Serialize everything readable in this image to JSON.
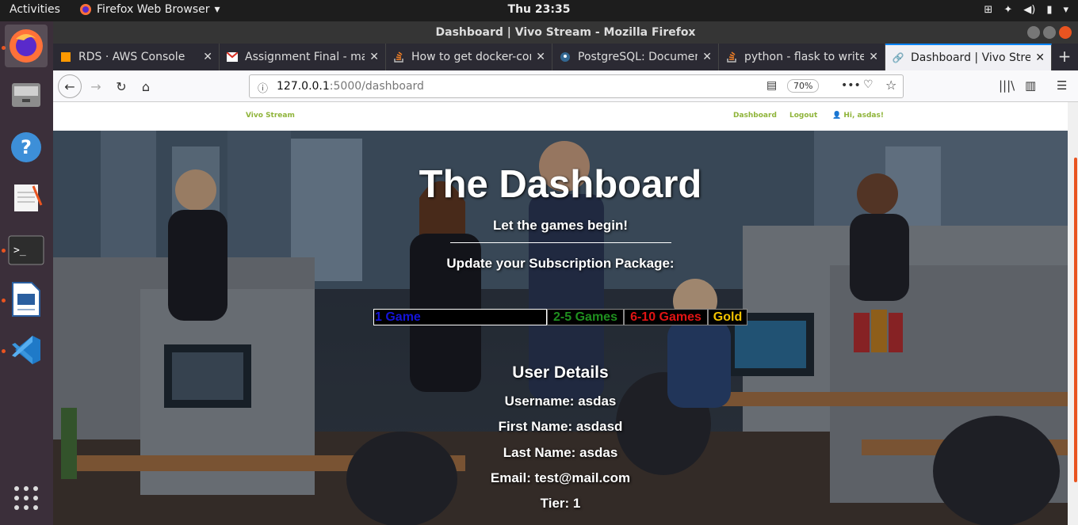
{
  "topbar": {
    "activities": "Activities",
    "app_name": "Firefox Web Browser",
    "clock": "Thu 23:35"
  },
  "window": {
    "title": "Dashboard | Vivo Stream - Mozilla Firefox"
  },
  "tabs": [
    {
      "label": "RDS · AWS Console",
      "icon": "cube-icon"
    },
    {
      "label": "Assignment Final - mat",
      "icon": "gmail-icon"
    },
    {
      "label": "How to get docker-con",
      "icon": "stackoverflow-icon"
    },
    {
      "label": "PostgreSQL: Documen",
      "icon": "postgres-icon"
    },
    {
      "label": "python - flask to write",
      "icon": "stackoverflow-icon"
    },
    {
      "label": "Dashboard | Vivo Strea",
      "icon": "link-icon",
      "active": true
    }
  ],
  "navbar": {
    "url_host": "127.0.0.1",
    "url_path": ":5000/dashboard",
    "zoom": "70%"
  },
  "site": {
    "brand": "Vivo Stream",
    "nav_dashboard": "Dashboard",
    "nav_logout": "Logout",
    "nav_user": "Hi, asdas!",
    "accent_color": "#8fb43a"
  },
  "hero": {
    "title": "The Dashboard",
    "subtitle": "Let the games begin!",
    "update_label": "Update your Subscription Package:"
  },
  "packages": [
    {
      "label": "1 Game",
      "color": "#1414d8"
    },
    {
      "label": "2-5 Games",
      "color": "#1f8f1f"
    },
    {
      "label": "6-10 Games",
      "color": "#e01414"
    },
    {
      "label": "Gold",
      "color": "#f2c200"
    }
  ],
  "user_details": {
    "heading": "User Details",
    "username": "Username: asdas",
    "first_name": "First Name: asdasd",
    "last_name": "Last Name: asdas",
    "email": "Email: test@mail.com",
    "tier": "Tier: 1"
  }
}
